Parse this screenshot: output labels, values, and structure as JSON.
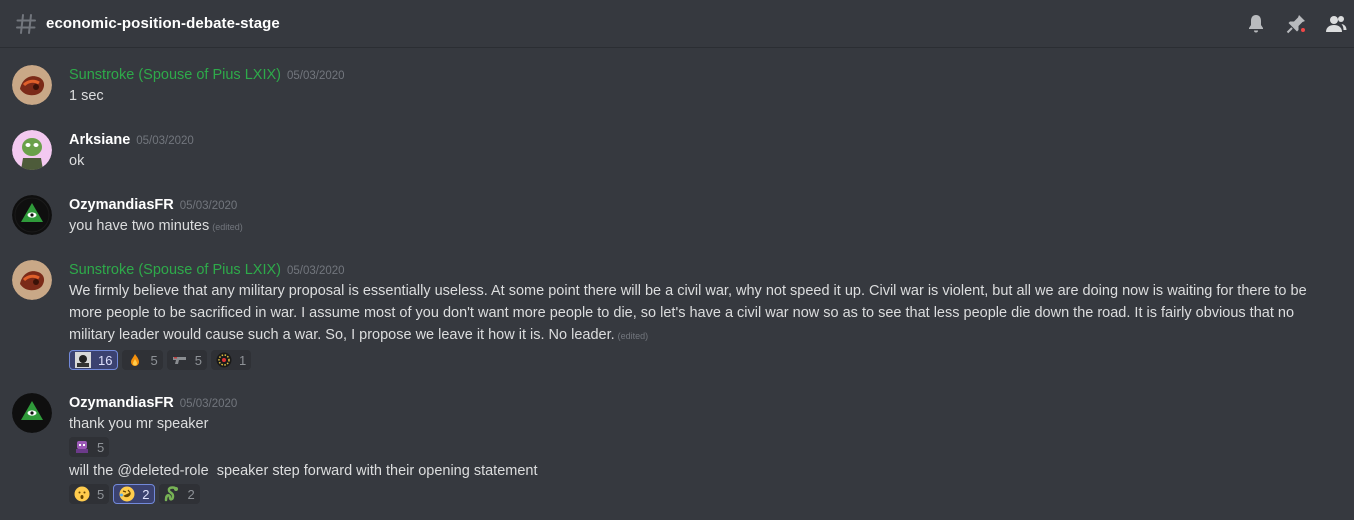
{
  "channel": {
    "name": "economic-position-debate-stage"
  },
  "header_icons": [
    "bell-icon",
    "pin-icon",
    "members-icon"
  ],
  "colors": {
    "background": "#36393f",
    "green_name": "#2eaa4a",
    "mention_dot": "#f04747"
  },
  "messages": [
    {
      "author": "Sunstroke (Spouse of Pius LXIX)",
      "timestamp": "05/03/2020",
      "text": "1 sec"
    },
    {
      "author": "Arksiane",
      "timestamp": "05/03/2020",
      "text": "ok"
    },
    {
      "author": "OzymandiasFR",
      "timestamp": "05/03/2020",
      "text": "you have two minutes",
      "edited": "(edited)"
    },
    {
      "author": "Sunstroke (Spouse of Pius LXIX)",
      "timestamp": "05/03/2020",
      "text": "We firmly believe that any military proposal is essentially useless. At some point there will be a civil war, why not speed it up. Civil war is violent, but all we are doing now is waiting for there to be more people to be sacrificed in war. I assume most of you don't want more people to die, so let's have a civil war now so as to see that less people die down the road. It is fairly obvious that no military leader would cause such a war. So, I propose we leave it how it is. No leader.",
      "edited": "(edited)",
      "reactions": [
        {
          "emoji": "custom-face-emoji",
          "count": "16",
          "active": true
        },
        {
          "emoji": "fire-emoji",
          "count": "5"
        },
        {
          "emoji": "gun-emoji",
          "count": "5"
        },
        {
          "emoji": "flag-emoji",
          "count": "1"
        }
      ]
    },
    {
      "author": "OzymandiasFR",
      "timestamp": "05/03/2020",
      "text": "thank you mr speaker",
      "reactions": [
        {
          "emoji": "purple-custom-emoji",
          "count": "5"
        }
      ],
      "followup_text_before": "will the ",
      "followup_mention": "@deleted-role",
      "followup_text_after": "  speaker step forward with their opening statement",
      "followup_reactions": [
        {
          "emoji": "hushed-face-emoji",
          "count": "5"
        },
        {
          "emoji": "rofl-emoji",
          "count": "2",
          "active": true
        },
        {
          "emoji": "snake-emoji",
          "count": "2"
        }
      ]
    }
  ]
}
